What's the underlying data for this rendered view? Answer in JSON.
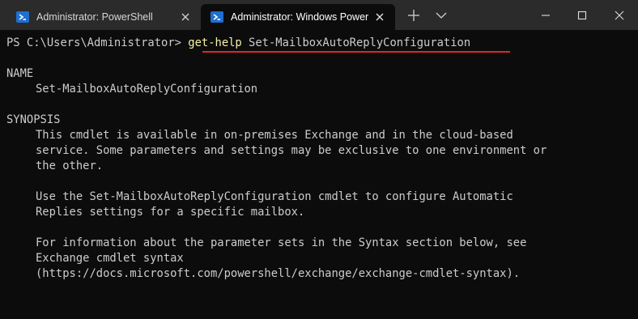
{
  "tabs": [
    {
      "label": "Administrator: PowerShell",
      "active": false,
      "icon": "powershell-icon"
    },
    {
      "label": "Administrator: Windows PowerS",
      "active": true,
      "icon": "powershell-icon"
    }
  ],
  "titlebar_buttons": {
    "new_tab_icon": "plus-icon",
    "dropdown_icon": "chevron-down-icon",
    "minimize_icon": "minimize-icon",
    "maximize_icon": "maximize-icon",
    "close_icon": "close-icon"
  },
  "colors": {
    "titlebar_bg": "#2b2b2b",
    "terminal_bg": "#0c0c0c",
    "terminal_text": "#cccccc",
    "command_highlight": "#f9f1a5",
    "underline": "#e0242c"
  },
  "terminal": {
    "prompt": "PS C:\\Users\\Administrator> ",
    "command_name": "get-help",
    "command_arg": " Set-MailboxAutoReplyConfiguration",
    "name_heading": "NAME",
    "name_value": "Set-MailboxAutoReplyConfiguration",
    "synopsis_heading": "SYNOPSIS",
    "synopsis_lines": [
      "This cmdlet is available in on-premises Exchange and in the cloud-based",
      "service. Some parameters and settings may be exclusive to one environment or",
      "the other.",
      "",
      "Use the Set-MailboxAutoReplyConfiguration cmdlet to configure Automatic",
      "Replies settings for a specific mailbox.",
      "",
      "For information about the parameter sets in the Syntax section below, see",
      "Exchange cmdlet syntax",
      "(https://docs.microsoft.com/powershell/exchange/exchange-cmdlet-syntax)."
    ]
  }
}
